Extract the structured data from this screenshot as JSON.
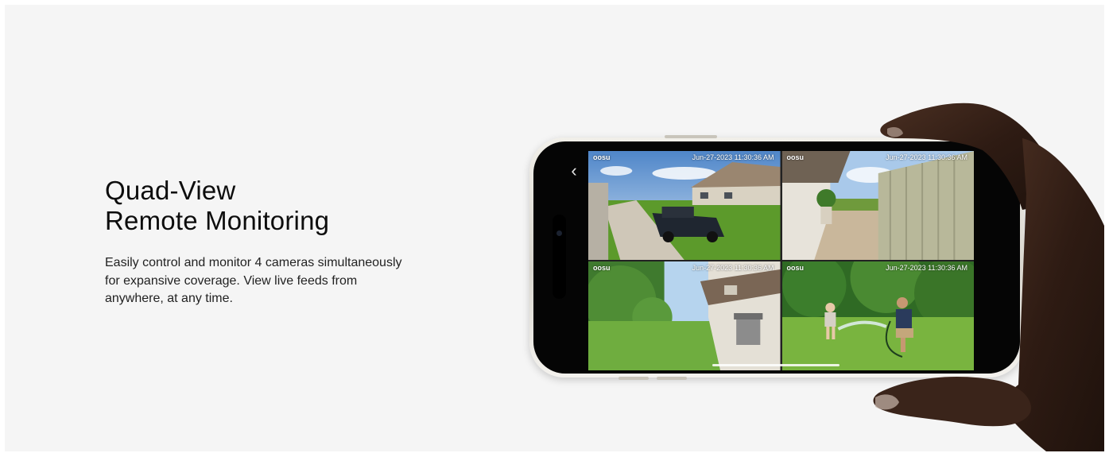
{
  "headline": {
    "line1": "Quad-View",
    "line2": "Remote Monitoring"
  },
  "description": "Easily control and monitor 4 cameras simultaneously for expansive coverage. View live feeds from anywhere, at any time.",
  "feeds": [
    {
      "brand": "oosu",
      "timestamp": "Jun-27-2023 11:30:36 AM",
      "scene": "driveway with pickup truck"
    },
    {
      "brand": "oosu",
      "timestamp": "Jun-27-2023 11:30:36 AM",
      "scene": "side yard with fence"
    },
    {
      "brand": "oosu",
      "timestamp": "Jun-27-2023 11:30:36 AM",
      "scene": "backyard with grill"
    },
    {
      "brand": "oosu",
      "timestamp": "Jun-27-2023 11:30:36 AM",
      "scene": "lawn with garden hose"
    }
  ],
  "icons": {
    "back": "chevron-left-icon"
  },
  "colors": {
    "panel_bg": "#f5f5f5",
    "text": "#0d0d0d",
    "phone_frame": "#e8e5de"
  }
}
